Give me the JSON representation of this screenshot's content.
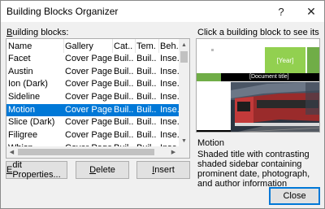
{
  "window": {
    "title": "Building Blocks Organizer",
    "help_label": "?",
    "close_label": "✕"
  },
  "blocks_label_accel": "B",
  "blocks_label_rest": "uilding blocks:",
  "columns": [
    "Name",
    "Gallery",
    "Cat...",
    "Tem...",
    "Beh..."
  ],
  "rows": [
    {
      "name": "Facet",
      "gallery": "Cover Pages",
      "category": "Buil...",
      "template": "Buil...",
      "behavior": "Inse..."
    },
    {
      "name": "Austin",
      "gallery": "Cover Pages",
      "category": "Buil...",
      "template": "Buil...",
      "behavior": "Inse..."
    },
    {
      "name": "Ion (Dark)",
      "gallery": "Cover Pages",
      "category": "Buil...",
      "template": "Buil...",
      "behavior": "Inse..."
    },
    {
      "name": "Sideline",
      "gallery": "Cover Pages",
      "category": "Buil...",
      "template": "Buil...",
      "behavior": "Inse..."
    },
    {
      "name": "Motion",
      "gallery": "Cover Pages",
      "category": "Buil...",
      "template": "Buil...",
      "behavior": "Inse...",
      "selected": true
    },
    {
      "name": "Slice (Dark)",
      "gallery": "Cover Pages",
      "category": "Buil...",
      "template": "Buil...",
      "behavior": "Inse..."
    },
    {
      "name": "Filigree",
      "gallery": "Cover Pages",
      "category": "Buil...",
      "template": "Buil...",
      "behavior": "Inse..."
    },
    {
      "name": "Whisp",
      "gallery": "Cover Pages",
      "category": "Buil...",
      "template": "Buil...",
      "behavior": "Inse..."
    }
  ],
  "buttons": {
    "edit_accel": "E",
    "edit_rest": "dit Properties...",
    "delete_accel": "D",
    "delete_rest": "elete",
    "insert_accel": "I",
    "insert_rest": "nsert",
    "close": "Close"
  },
  "preview": {
    "label": "Click a building block to see its preview",
    "year": "[Year]",
    "doc_title": "[Document title]"
  },
  "selected_block": {
    "name": "Motion",
    "description": "Shaded title with contrasting shaded sidebar containing prominent date, photograph, and author information"
  },
  "icons": {
    "scroll_up": "scroll-up-icon",
    "scroll_down": "scroll-down-icon",
    "scroll_left": "scroll-left-icon",
    "scroll_right": "scroll-right-icon"
  },
  "colors": {
    "selection": "#0078d7",
    "accent_green": "#92d050",
    "dark_green": "#70ad47"
  }
}
